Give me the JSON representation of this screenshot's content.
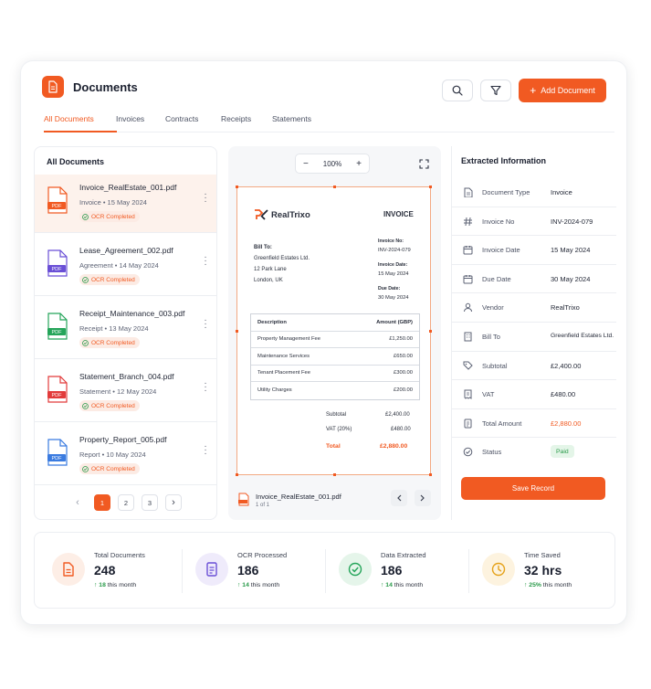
{
  "header": {
    "title": "Documents",
    "add_label": "Add Document"
  },
  "tabs": [
    {
      "label": "All Documents",
      "active": true
    },
    {
      "label": "Invoices"
    },
    {
      "label": "Contracts"
    },
    {
      "label": "Receipts"
    },
    {
      "label": "Statements"
    }
  ],
  "list": {
    "title": "All Documents",
    "items": [
      {
        "name": "Invoice_RealEstate_001.pdf",
        "meta": "Invoice • 15 May 2024",
        "status": "OCR Completed",
        "icon_color": "#f15a22",
        "badge": "PDF"
      },
      {
        "name": "Lease_Agreement_002.pdf",
        "meta": "Agreement • 14 May 2024",
        "status": "OCR Completed",
        "icon_color": "#6a4fd6",
        "badge": "PDF"
      },
      {
        "name": "Receipt_Maintenance_003.pdf",
        "meta": "Receipt • 13 May 2024",
        "status": "OCR Completed",
        "icon_color": "#25a55a",
        "badge": "PDF"
      },
      {
        "name": "Statement_Branch_004.pdf",
        "meta": "Statement • 12 May 2024",
        "status": "OCR Completed",
        "icon_color": "#e23b3b",
        "badge": "PDF"
      },
      {
        "name": "Property_Report_005.pdf",
        "meta": "Report • 10 May 2024",
        "status": "OCR Completed",
        "icon_color": "#3a7be0",
        "badge": "PDF"
      }
    ],
    "pages": [
      "1",
      "2",
      "3"
    ],
    "prev": "‹",
    "next": "›"
  },
  "viewer": {
    "zoom": "100%",
    "minus": "−",
    "plus": "+",
    "file_name": "Invoice_RealEstate_001.pdf",
    "page_info": "1 of 1",
    "invoice": {
      "brand": "RealTrixo",
      "heading": "INVOICE",
      "bill_to_label": "Bill To:",
      "bill_to_lines": [
        "Greenfield Estates Ltd.",
        "12 Park Lane",
        "London, UK"
      ],
      "invoice_no_label": "Invoice No:",
      "invoice_no": "INV-2024-079",
      "invoice_date_label": "Invoice Date:",
      "invoice_date": "15 May 2024",
      "due_date_label": "Due Date:",
      "due_date": "30 May 2024",
      "col_desc": "Description",
      "col_amount": "Amount (GBP)",
      "rows": [
        {
          "desc": "Property Management Fee",
          "amount": "£1,250.00"
        },
        {
          "desc": "Maintenance Services",
          "amount": "£650.00"
        },
        {
          "desc": "Tenant Placement Fee",
          "amount": "£300.00"
        },
        {
          "desc": "Utility Charges",
          "amount": "£200.00"
        }
      ],
      "subtotal_label": "Subtotal",
      "subtotal": "£2,400.00",
      "vat_label": "VAT (20%)",
      "vat": "£480.00",
      "total_label": "Total",
      "total": "£2,880.00"
    }
  },
  "extracted": {
    "title": "Extracted Information",
    "fields": [
      {
        "label": "Document Type",
        "value": "Invoice",
        "icon": "document-icon"
      },
      {
        "label": "Invoice No",
        "value": "INV-2024-079",
        "icon": "hash-icon"
      },
      {
        "label": "Invoice Date",
        "value": "15 May 2024",
        "icon": "calendar-icon"
      },
      {
        "label": "Due Date",
        "value": "30 May 2024",
        "icon": "calendar-icon"
      },
      {
        "label": "Vendor",
        "value": "RealTrixo",
        "icon": "user-icon"
      },
      {
        "label": "Bill To",
        "value": "Greenfield Estates Ltd.",
        "icon": "building-icon"
      },
      {
        "label": "Subtotal",
        "value": "£2,400.00",
        "icon": "tag-icon"
      },
      {
        "label": "VAT",
        "value": "£480.00",
        "icon": "receipt-icon"
      },
      {
        "label": "Total Amount",
        "value": "£2,880.00",
        "icon": "invoice-icon"
      },
      {
        "label": "Status",
        "value": "Paid",
        "icon": "check-circle-icon"
      }
    ],
    "save_label": "Save Record"
  },
  "stats": [
    {
      "label": "Total Documents",
      "value": "248",
      "delta": "18",
      "delta_suffix": "this month",
      "color": "#f15a22",
      "bg": "#fdeee6",
      "icon": "document-icon"
    },
    {
      "label": "OCR Processed",
      "value": "186",
      "delta": "14",
      "delta_suffix": "this month",
      "color": "#6a4fd6",
      "bg": "#efebfb",
      "icon": "file-scan-icon"
    },
    {
      "label": "Data Extracted",
      "value": "186",
      "delta": "14",
      "delta_suffix": "this month",
      "color": "#25a55a",
      "bg": "#e5f5ea",
      "icon": "check-badge-icon"
    },
    {
      "label": "Time Saved",
      "value": "32 hrs",
      "delta": "25%",
      "delta_suffix": "this month",
      "color": "#e5a21a",
      "bg": "#fdf3df",
      "icon": "clock-icon"
    }
  ],
  "colors": {
    "accent": "#f15a22",
    "success": "#2a9a4a"
  }
}
